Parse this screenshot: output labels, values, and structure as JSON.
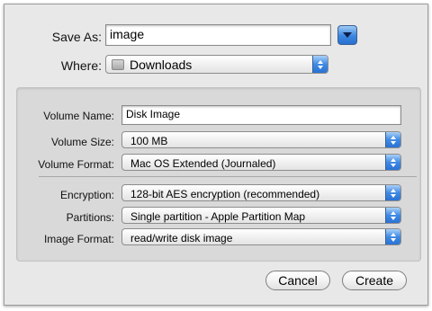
{
  "save_as": {
    "label": "Save As:",
    "value": "image"
  },
  "where": {
    "label": "Where:",
    "value": "Downloads"
  },
  "options": {
    "volume_name": {
      "label": "Volume Name:",
      "value": "Disk Image"
    },
    "volume_size": {
      "label": "Volume Size:",
      "value": "100 MB"
    },
    "volume_format": {
      "label": "Volume Format:",
      "value": "Mac OS Extended (Journaled)"
    },
    "encryption": {
      "label": "Encryption:",
      "value": "128-bit AES encryption (recommended)"
    },
    "partitions": {
      "label": "Partitions:",
      "value": "Single partition - Apple Partition Map"
    },
    "image_format": {
      "label": "Image Format:",
      "value": "read/write disk image"
    }
  },
  "buttons": {
    "cancel": "Cancel",
    "create": "Create"
  },
  "colors": {
    "accent": "#3b86e0",
    "sheet_bg": "#e8e8e8",
    "group_bg": "#d9d9d9"
  },
  "icons": {
    "disclosure": "disclosure-triangle-icon",
    "folder": "downloads-folder-icon",
    "popup": "popup-arrows-icon"
  }
}
